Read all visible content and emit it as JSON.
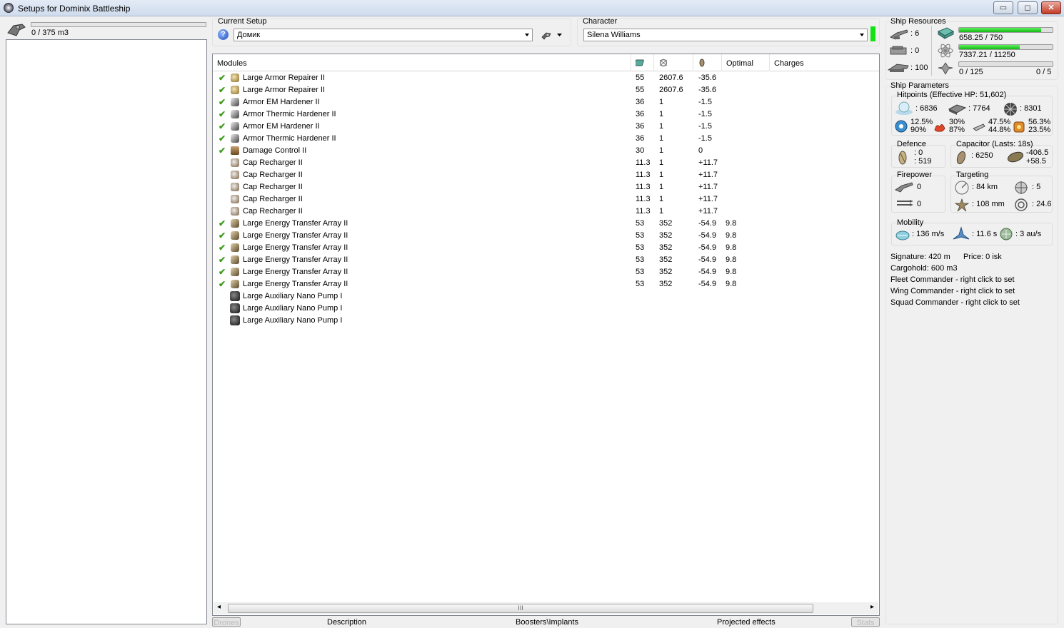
{
  "window": {
    "title": "Setups for Dominix Battleship",
    "minimize": "▭",
    "maximize": "◻",
    "close": "✕"
  },
  "left": {
    "cargo": "0 / 375 m3",
    "icon": "ship-icon"
  },
  "setup": {
    "label": "Current Setup",
    "value": "Домик"
  },
  "character": {
    "label": "Character",
    "value": "Silena Williams",
    "status_color": "#12e312"
  },
  "modules": {
    "headers": [
      "Modules",
      "",
      "",
      "",
      "Optimal",
      "Charges"
    ],
    "rows": [
      {
        "name": "Large Armor Repairer II",
        "active": true,
        "cpu": "55",
        "pg": "2607.6",
        "cap": "-35.6",
        "optimal": "",
        "icon": "armor-repairer-icon"
      },
      {
        "name": "Large Armor Repairer II",
        "active": true,
        "cpu": "55",
        "pg": "2607.6",
        "cap": "-35.6",
        "optimal": "",
        "icon": "armor-repairer-icon"
      },
      {
        "name": "Armor EM Hardener II",
        "active": true,
        "cpu": "36",
        "pg": "1",
        "cap": "-1.5",
        "optimal": "",
        "icon": "hardener-icon"
      },
      {
        "name": "Armor Thermic Hardener II",
        "active": true,
        "cpu": "36",
        "pg": "1",
        "cap": "-1.5",
        "optimal": "",
        "icon": "hardener-icon"
      },
      {
        "name": "Armor EM Hardener II",
        "active": true,
        "cpu": "36",
        "pg": "1",
        "cap": "-1.5",
        "optimal": "",
        "icon": "hardener-icon"
      },
      {
        "name": "Armor Thermic Hardener II",
        "active": true,
        "cpu": "36",
        "pg": "1",
        "cap": "-1.5",
        "optimal": "",
        "icon": "hardener-icon"
      },
      {
        "name": "Damage Control II",
        "active": true,
        "cpu": "30",
        "pg": "1",
        "cap": "0",
        "optimal": "",
        "icon": "damage-control-icon"
      },
      {
        "name": "Cap Recharger II",
        "active": false,
        "cpu": "11.3",
        "pg": "1",
        "cap": "+11.7",
        "optimal": "",
        "icon": "cap-recharger-icon"
      },
      {
        "name": "Cap Recharger II",
        "active": false,
        "cpu": "11.3",
        "pg": "1",
        "cap": "+11.7",
        "optimal": "",
        "icon": "cap-recharger-icon"
      },
      {
        "name": "Cap Recharger II",
        "active": false,
        "cpu": "11.3",
        "pg": "1",
        "cap": "+11.7",
        "optimal": "",
        "icon": "cap-recharger-icon"
      },
      {
        "name": "Cap Recharger II",
        "active": false,
        "cpu": "11.3",
        "pg": "1",
        "cap": "+11.7",
        "optimal": "",
        "icon": "cap-recharger-icon"
      },
      {
        "name": "Cap Recharger II",
        "active": false,
        "cpu": "11.3",
        "pg": "1",
        "cap": "+11.7",
        "optimal": "",
        "icon": "cap-recharger-icon"
      },
      {
        "name": "Large Energy Transfer Array II",
        "active": true,
        "cpu": "53",
        "pg": "352",
        "cap": "-54.9",
        "optimal": "9.8",
        "icon": "energy-transfer-icon"
      },
      {
        "name": "Large Energy Transfer Array II",
        "active": true,
        "cpu": "53",
        "pg": "352",
        "cap": "-54.9",
        "optimal": "9.8",
        "icon": "energy-transfer-icon"
      },
      {
        "name": "Large Energy Transfer Array II",
        "active": true,
        "cpu": "53",
        "pg": "352",
        "cap": "-54.9",
        "optimal": "9.8",
        "icon": "energy-transfer-icon"
      },
      {
        "name": "Large Energy Transfer Array II",
        "active": true,
        "cpu": "53",
        "pg": "352",
        "cap": "-54.9",
        "optimal": "9.8",
        "icon": "energy-transfer-icon"
      },
      {
        "name": "Large Energy Transfer Array II",
        "active": true,
        "cpu": "53",
        "pg": "352",
        "cap": "-54.9",
        "optimal": "9.8",
        "icon": "energy-transfer-icon"
      },
      {
        "name": "Large Energy Transfer Array II",
        "active": true,
        "cpu": "53",
        "pg": "352",
        "cap": "-54.9",
        "optimal": "9.8",
        "icon": "energy-transfer-icon"
      },
      {
        "name": "Large Auxiliary Nano Pump I",
        "active": false,
        "cpu": "",
        "pg": "",
        "cap": "",
        "optimal": "",
        "icon": "rig-icon"
      },
      {
        "name": "Large Auxiliary Nano Pump I",
        "active": false,
        "cpu": "",
        "pg": "",
        "cap": "",
        "optimal": "",
        "icon": "rig-icon"
      },
      {
        "name": "Large Auxiliary Nano Pump I",
        "active": false,
        "cpu": "",
        "pg": "",
        "cap": "",
        "optimal": "",
        "icon": "rig-icon"
      }
    ],
    "check_glyph": "✔",
    "scroll_grip": "III",
    "scroll_left": "◂",
    "scroll_right": "▸"
  },
  "bottom_tabs": {
    "drones": "Drones",
    "description": "Description",
    "boosters": "Boosters\\Implants",
    "projected": "Projected effects",
    "stats": "Stats"
  },
  "resources": {
    "title": "Ship Resources",
    "turret_slots": ": 6",
    "launcher_slots": ": 0",
    "calibration": ": 100",
    "cpu": "658.25 / 750",
    "cpu_fraction": 0.877,
    "powergrid": "7337.21 / 11250",
    "powergrid_fraction": 0.652,
    "drone_bay": "0 / 125",
    "drone_fraction": 0,
    "drones_active": "0 / 5"
  },
  "params": {
    "title": "Ship Parameters",
    "hp_title": "Hitpoints (Effective HP: 51,602)",
    "shield_hp": ": 6836",
    "armor_hp": ": 7764",
    "structure_hp": ": 8301",
    "res_em": [
      "12.5%",
      "90%"
    ],
    "res_thermal": [
      "30%",
      "87%"
    ],
    "res_kinetic": [
      "47.5%",
      "44.8%"
    ],
    "res_explosive": [
      "56.3%",
      "23.5%"
    ],
    "defence_title": "Defence",
    "defence": [
      ": 0",
      ": 519"
    ],
    "capacitor_title": "Capacitor (Lasts: 18s)",
    "cap_amount": ": 6250",
    "cap_delta": [
      "-406.5",
      "+58.5"
    ],
    "firepower_title": "Firepower",
    "firepower": [
      "0",
      "0"
    ],
    "targeting_title": "Targeting",
    "target_range": ": 84 km",
    "max_targets": ": 5",
    "scan_res": ": 108 mm",
    "sensor_strength": ": 24.6",
    "mobility_title": "Mobility",
    "velocity": ": 136 m/s",
    "align": ": 11.6 s",
    "warp": ": 3 au/s",
    "signature": "Signature: 420 m",
    "price": "Price: 0 isk",
    "cargohold": "Cargohold: 600 m3",
    "fleet_cmd": "Fleet Commander - right click to set",
    "wing_cmd": "Wing Commander - right click to set",
    "squad_cmd": "Squad Commander - right click to set"
  }
}
